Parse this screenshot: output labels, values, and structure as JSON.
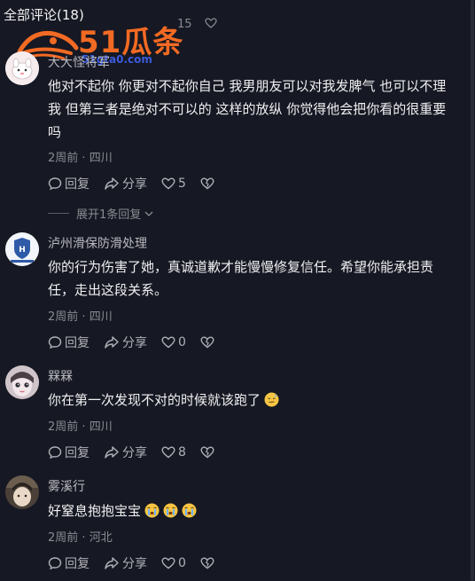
{
  "header": {
    "title": "全部评论(18)",
    "peek_count": "15"
  },
  "watermark": {
    "brand": "51瓜条",
    "sub": "51gta0.com"
  },
  "comments": [
    {
      "username": "大大怪将军",
      "text": "他对不起你 你更对不起你自己 我男朋友可以对我发脾气 也可以不理我 但第三者是绝对不可以的 这样的放纵 你觉得他会把你看的很重要吗",
      "time": "2周前",
      "location": "四川",
      "reply_label": "回复",
      "share_label": "分享",
      "likes": "5",
      "expand_label": "展开1条回复"
    },
    {
      "username": "泸州滑保防滑处理",
      "text": "你的行为伤害了她，真诚道歉才能慢慢修复信任。希望你能承担责任，走出这段关系。",
      "time": "2周前",
      "location": "四川",
      "reply_label": "回复",
      "share_label": "分享",
      "likes": "0"
    },
    {
      "username": "槑槑",
      "text": "你在第一次发现不对的时候就该跑了",
      "time": "2周前",
      "location": "四川",
      "reply_label": "回复",
      "share_label": "分享",
      "likes": "8"
    },
    {
      "username": "雾溪行",
      "text": "好窒息抱抱宝宝",
      "time": "2周前",
      "location": "河北",
      "reply_label": "回复",
      "share_label": "分享",
      "likes": "0"
    }
  ],
  "colors": {
    "background": "#161823",
    "watermark_orange": "#f26a23",
    "watermark_blue": "#3b5bdb"
  },
  "icons": [
    "reply-icon",
    "share-icon",
    "heart-icon",
    "dislike-heart-icon",
    "chevron-down-icon",
    "close-icon"
  ]
}
